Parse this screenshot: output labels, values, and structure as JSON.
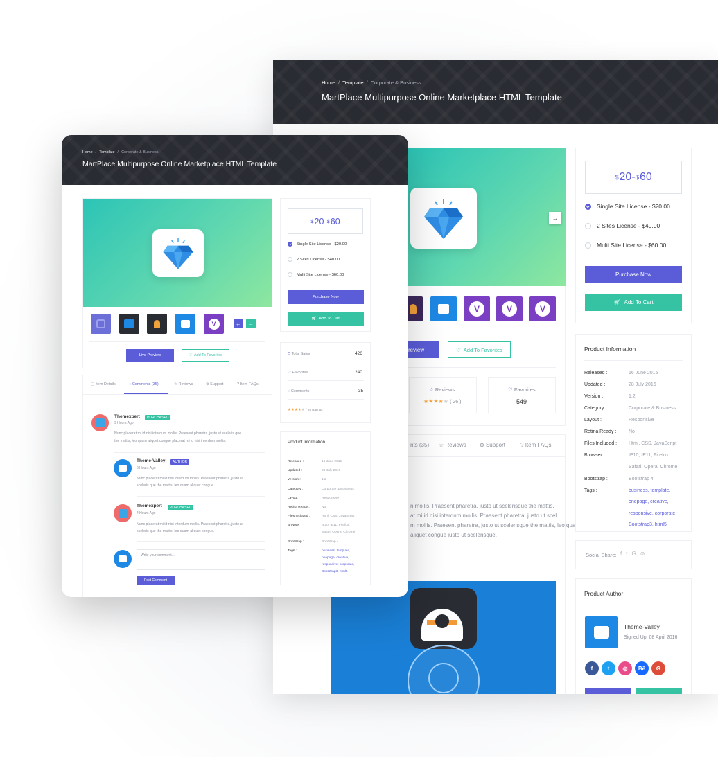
{
  "breadcrumb": {
    "home": "Home",
    "template": "Template",
    "current": "Corporate & Business",
    "sep": "/"
  },
  "title": "MartPlace Multipurpose Online Marketplace HTML Template",
  "price": {
    "low": "20",
    "high": "60",
    "currency": "$",
    "dash": " - "
  },
  "licenses": [
    {
      "label": "Single Site License - $20.00",
      "selected": true
    },
    {
      "label": "2 Sites License - $40.00",
      "selected": false
    },
    {
      "label": "Multi Site License - $60.00",
      "selected": false
    }
  ],
  "buttons": {
    "purchase": "Purchase Now",
    "cart": "Add To Cart",
    "preview": "Live Preview",
    "favorites": "Add To Favorites",
    "post": "Post Comment",
    "preview_partial": "review"
  },
  "stats": {
    "sales_label": "Total Sales",
    "sales": "426",
    "favorites_label": "Favorites",
    "favorites": "240",
    "comments_label": "Comments",
    "comments": "35",
    "ratings": "( 26 Ratings )",
    "reviews_label": "Reviews",
    "reviews_count": "( 26 )",
    "fav_count": "549"
  },
  "tabs": {
    "details": "Item Details",
    "comments": "Comments (35)",
    "reviews": "Reviews",
    "support": "Support",
    "faqs": "Item FAQs",
    "comments_partial": "nts (35)"
  },
  "info": {
    "heading": "Product Information",
    "rows": [
      {
        "k": "Released :",
        "v": "16 June 2015"
      },
      {
        "k": "Updated :",
        "v": "28 July 2016"
      },
      {
        "k": "Version :",
        "v": "1.2"
      },
      {
        "k": "Category :",
        "v": "Corporate & Business"
      },
      {
        "k": "Layout :",
        "v": "Responsive"
      },
      {
        "k": "Retina Ready :",
        "v": "No"
      },
      {
        "k": "Files Included :",
        "v": "Html, CSS, JavaScript"
      },
      {
        "k": "Browser :",
        "v": "IE10, IE11, Firefox,"
      },
      {
        "k": "",
        "v": "Safari, Opera, Chrome"
      },
      {
        "k": "Bootstrap :",
        "v": "Bootstrap 4"
      },
      {
        "k": "Tags :",
        "v": "business, template,"
      },
      {
        "k": "",
        "v": "onepage, creative,"
      },
      {
        "k": "",
        "v": "responsive, corporate,"
      },
      {
        "k": "",
        "v": "Bootstrap3, html5"
      }
    ]
  },
  "social": {
    "label": "Social Share:"
  },
  "author": {
    "heading": "Product Author",
    "name": "Theme-Valley",
    "signed": "Signed Up: 08 April 2016"
  },
  "comments": [
    {
      "name": "Themexpert",
      "badge": "PURCHASED",
      "time": "9 Hours Ago",
      "line1": "Nunc placerat mi id nisi interdum mollis. Praesent pharetra, justo ut sceleris que",
      "line2": "the mattis, leo quam aliquet congue placerat mi id nisi interdum mollis."
    },
    {
      "name": "Theme-Valley",
      "badge": "AUTHOR",
      "time": "6 Hours Ago",
      "line1": "Nunc placerat mi id nisi interdum mollis. Praesent pharetra, justo ut",
      "line2": "sceleris que the mattis, leo quam aliquet congue."
    },
    {
      "name": "Themexpert",
      "badge": "PURCHASED",
      "time": "4 Hours Ago",
      "line1": "Nunc placerat mi id nisi interdum mollis. Praesent pharetra, justo ut",
      "line2": "sceleris que the mattis, leo quam aliquet congue."
    }
  ],
  "reply_placeholder": "Write your comment...",
  "desc": {
    "l1": "n mollis. Praesent pharetra, justo ut scelerisque the mattis.",
    "l2": "at mi id nisi interdum mollis. Praesent pharetra, justo ut scel",
    "l3": "m mollis. Praesent pharetra, justo ut scelerisque the mattis, leo quam ut",
    "l4": "aliquet congue justo ut scelerisque."
  },
  "thumb_v": "V",
  "colors": {
    "accent": "#5a5cd8",
    "green": "#35c3a4",
    "dark": "#2a2c33"
  }
}
